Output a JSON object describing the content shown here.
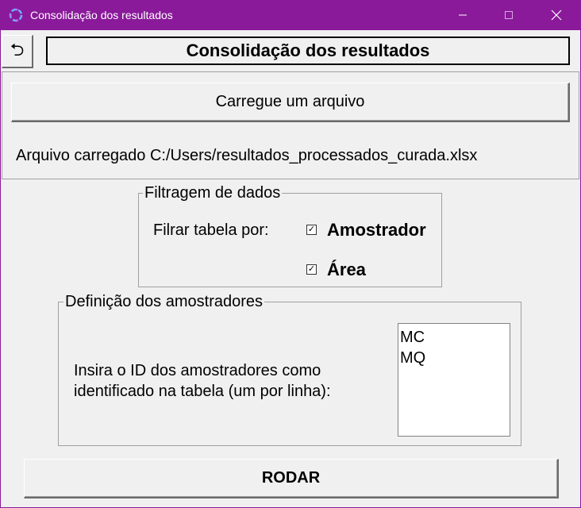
{
  "window": {
    "title": "Consolidação dos resultados",
    "titlebar_color": "#8a1a9a",
    "icon": "app-ring-icon",
    "controls": {
      "minimize": "minimize-icon",
      "maximize": "maximize-icon",
      "close": "close-icon"
    }
  },
  "header": {
    "back_icon": "undo-arrow-icon",
    "back_glyph": "⮌",
    "title": "Consolidação dos resultados"
  },
  "file": {
    "load_button": "Carregue um arquivo",
    "status": "Arquivo carregado C:/Users/resultados_processados_curada.xlsx"
  },
  "filter": {
    "legend": "Filtragem de dados",
    "label": "Filrar tabela por:",
    "options": [
      {
        "label": "Amostrador",
        "checked": true
      },
      {
        "label": "Área",
        "checked": true
      }
    ],
    "check_glyph": "✓"
  },
  "samplers": {
    "legend": "Definição dos amostradores",
    "instruction": "Insira o ID dos amostradores como identificado na tabela (um por linha):",
    "ids": [
      "MC",
      "MQ"
    ]
  },
  "run_button": "RODAR"
}
